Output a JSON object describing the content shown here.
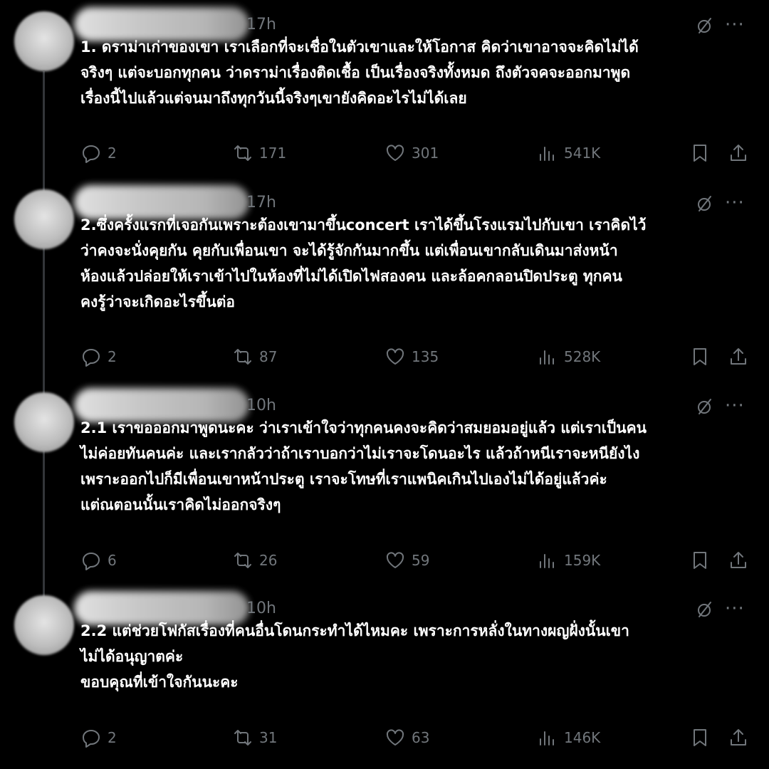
{
  "tweets": [
    {
      "time": "17h",
      "text": "1. ดราม่าเก่าของเขา เราเลือกที่จะเชื่อในตัวเขาและให้โอกาส คิดว่าเขาอาจจะคิดไม่ได้\nจริงๆ แต่จะบอกทุกคน ว่าดราม่าเรื่องติดเชื้อ เป็นเรื่องจริงทั้งหมด ถึงตัวจคจะออกมาพูด\nเรื่องนี้ไปแล้วแต่จนมาถึงทุกวันนี้จริงๆเขายังคิดอะไรไม่ได้เลย",
      "replies": "2",
      "reposts": "171",
      "likes": "301",
      "views": "541K"
    },
    {
      "time": "17h",
      "text": "2.ซึ่งครั้งแรกที่เจอกันเพราะต้องเขามาขึ้นconcert เราได้ขึ้นโรงแรมไปกับเขา เราคิดไว้\nว่าคงจะนั่งคุยกัน คุยกับเพื่อนเขา จะได้รู้จักกันมากขึ้น แต่เพื่อนเขากลับเดินมาส่งหน้า\nห้องแล้วปล่อยให้เราเข้าไปในห้องที่ไม่ได้เปิดไฟสองคน และล้อคกลอนปิดประตู ทุกคน\nคงรู้ว่าจะเกิดอะไรขึ้นต่อ",
      "replies": "2",
      "reposts": "87",
      "likes": "135",
      "views": "528K"
    },
    {
      "time": "10h",
      "text": "2.1 เราขอออกมาพูดนะคะ ว่าเราเข้าใจว่าทุกคนคงจะคิดว่าสมยอมอยู่แล้ว แต่เราเป็นคน\nไม่ค่อยทันคนค่ะ และเรากลัวว่าถ้าเราบอกว่าไม่เราจะโดนอะไร แล้วถ้าหนีเราจะหนียังไง\nเพราะออกไปก็มีเพื่อนเขาหน้าประตู เราจะโทษที่เราแพนิคเกินไปเองไม่ได้อยู่แล้วค่ะ\nแต่ณตอนนั้นเราคิดไม่ออกจริงๆ",
      "replies": "6",
      "reposts": "26",
      "likes": "59",
      "views": "159K"
    },
    {
      "time": "10h",
      "text": "2.2 แต่ช่วยโฟกัสเรื่องที่คนอื่นโดนกระทำได้ไหมคะ เพราะการหลั่งในทางผญฝั่งนั้นเขา\nไม่ได้อนุญาตค่ะ\nขอบคุณที่เข้าใจกันนะคะ",
      "replies": "2",
      "reposts": "31",
      "likes": "63",
      "views": "146K"
    }
  ],
  "icons": {
    "reply": "reply-icon",
    "repost": "repost-icon",
    "like": "heart-icon",
    "views": "views-icon",
    "bookmark": "bookmark-icon",
    "share": "share-icon",
    "grok": "grok-icon",
    "more": "more-icon"
  },
  "colors": {
    "background": "#000000",
    "text": "#ffffff",
    "muted": "#71767b"
  }
}
